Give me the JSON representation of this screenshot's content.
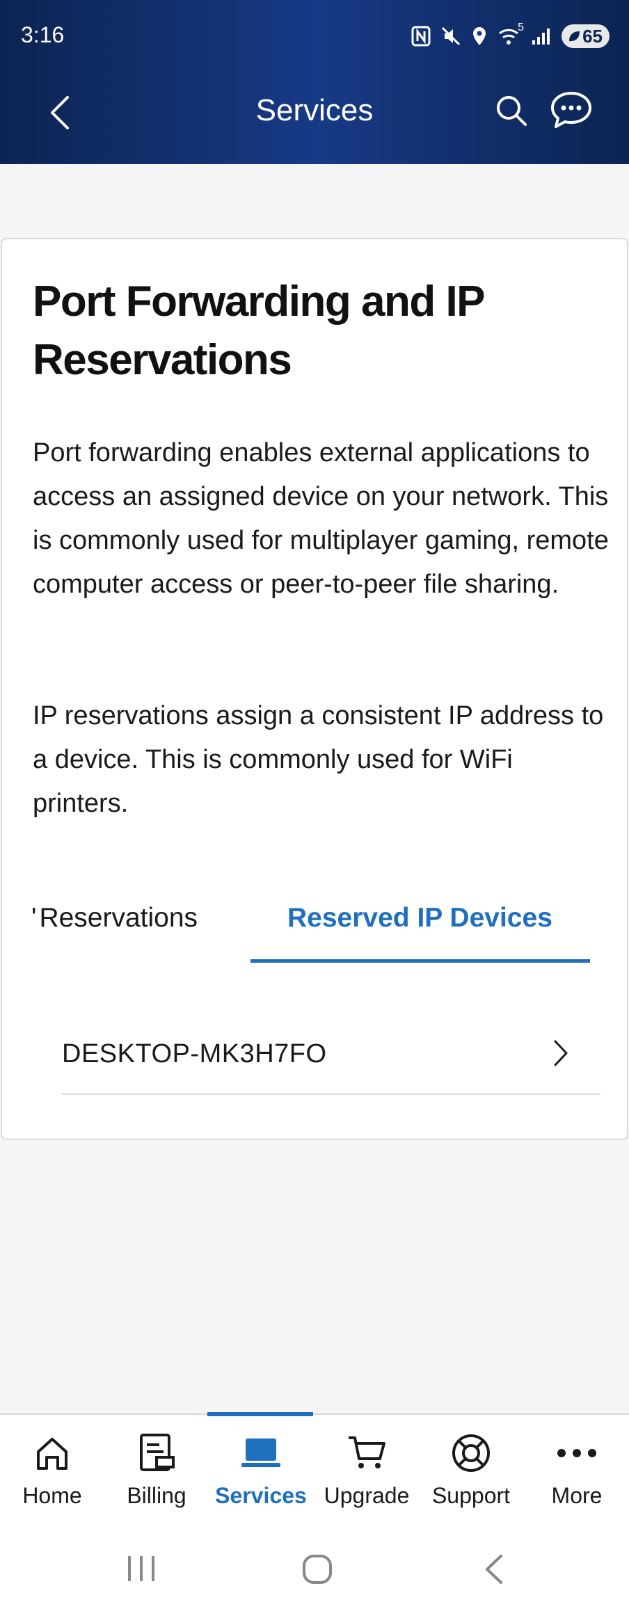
{
  "status_bar": {
    "time": "3:16",
    "battery": "65",
    "network_label": "5"
  },
  "header": {
    "title": "Services"
  },
  "card": {
    "title": "Port Forwarding and IP Reservations",
    "paragraph1": "Port forwarding enables external applications to access an assigned device on your network. This is commonly used for multiplayer gaming, remote computer access or peer-to-peer file sharing.",
    "paragraph2": "IP reservations assign a consistent IP address to a device. This is commonly used for WiFi printers.",
    "tabs": [
      {
        "label": "Reservations",
        "clipped_prefix": "'",
        "active": false
      },
      {
        "label": "Reserved IP Devices",
        "active": true
      }
    ],
    "devices": [
      {
        "name": "DESKTOP-MK3H7FO"
      }
    ]
  },
  "bottom_nav": {
    "items": [
      {
        "label": "Home",
        "icon": "home-icon"
      },
      {
        "label": "Billing",
        "icon": "billing-icon"
      },
      {
        "label": "Services",
        "icon": "laptop-icon",
        "active": true
      },
      {
        "label": "Upgrade",
        "icon": "cart-icon"
      },
      {
        "label": "Support",
        "icon": "lifebuoy-icon"
      },
      {
        "label": "More",
        "icon": "more-dots-icon"
      }
    ]
  },
  "colors": {
    "header_dark": "#0c2452",
    "header_mid": "#173a86",
    "accent": "#1f6fbf",
    "background": "#f5f5f5"
  }
}
